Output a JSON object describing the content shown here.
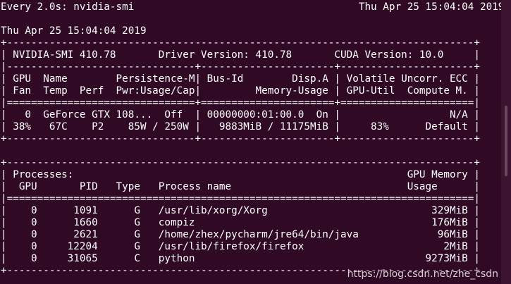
{
  "terminal": {
    "lines": [
      "Every 2.0s: nvidia-smi                                     Thu Apr 25 15:04:04 2019",
      "",
      "Thu Apr 25 15:04:04 2019",
      "+-----------------------------------------------------------------------------+",
      "| NVIDIA-SMI 410.78       Driver Version: 410.78       CUDA Version: 10.0     |",
      "|-------------------------------+----------------------+----------------------+",
      "| GPU  Name        Persistence-M| Bus-Id        Disp.A | Volatile Uncorr. ECC |",
      "| Fan  Temp  Perf  Pwr:Usage/Cap|         Memory-Usage | GPU-Util  Compute M. |",
      "|===============================+======================+======================|",
      "|   0  GeForce GTX 108...  Off  | 00000000:01:00.0  On |                  N/A |",
      "| 38%   67C    P2    85W / 250W |   9883MiB / 11175MiB |     83%      Default |",
      "+-------------------------------+----------------------+----------------------+",
      "",
      "+-----------------------------------------------------------------------------+",
      "| Processes:                                                       GPU Memory |",
      "|  GPU       PID   Type   Process name                             Usage      |",
      "|=============================================================================|",
      "|    0      1091      G   /usr/lib/xorg/Xorg                           329MiB |",
      "|    0      1660      G   compiz                                       176MiB |",
      "|    0      2621      G   /home/zhex/pycharm/jre64/bin/java             96MiB |",
      "|    0     12204      G   /usr/lib/firefox/firefox                       2MiB |",
      "|    0     31065      C   python                                      9273MiB |",
      "+-----------------------------------------------------------------------------+"
    ]
  },
  "watermark": "https://blog.csdn.net/zhe_csdn",
  "colors": {
    "background": "#300a24",
    "foreground": "#ffffff"
  }
}
